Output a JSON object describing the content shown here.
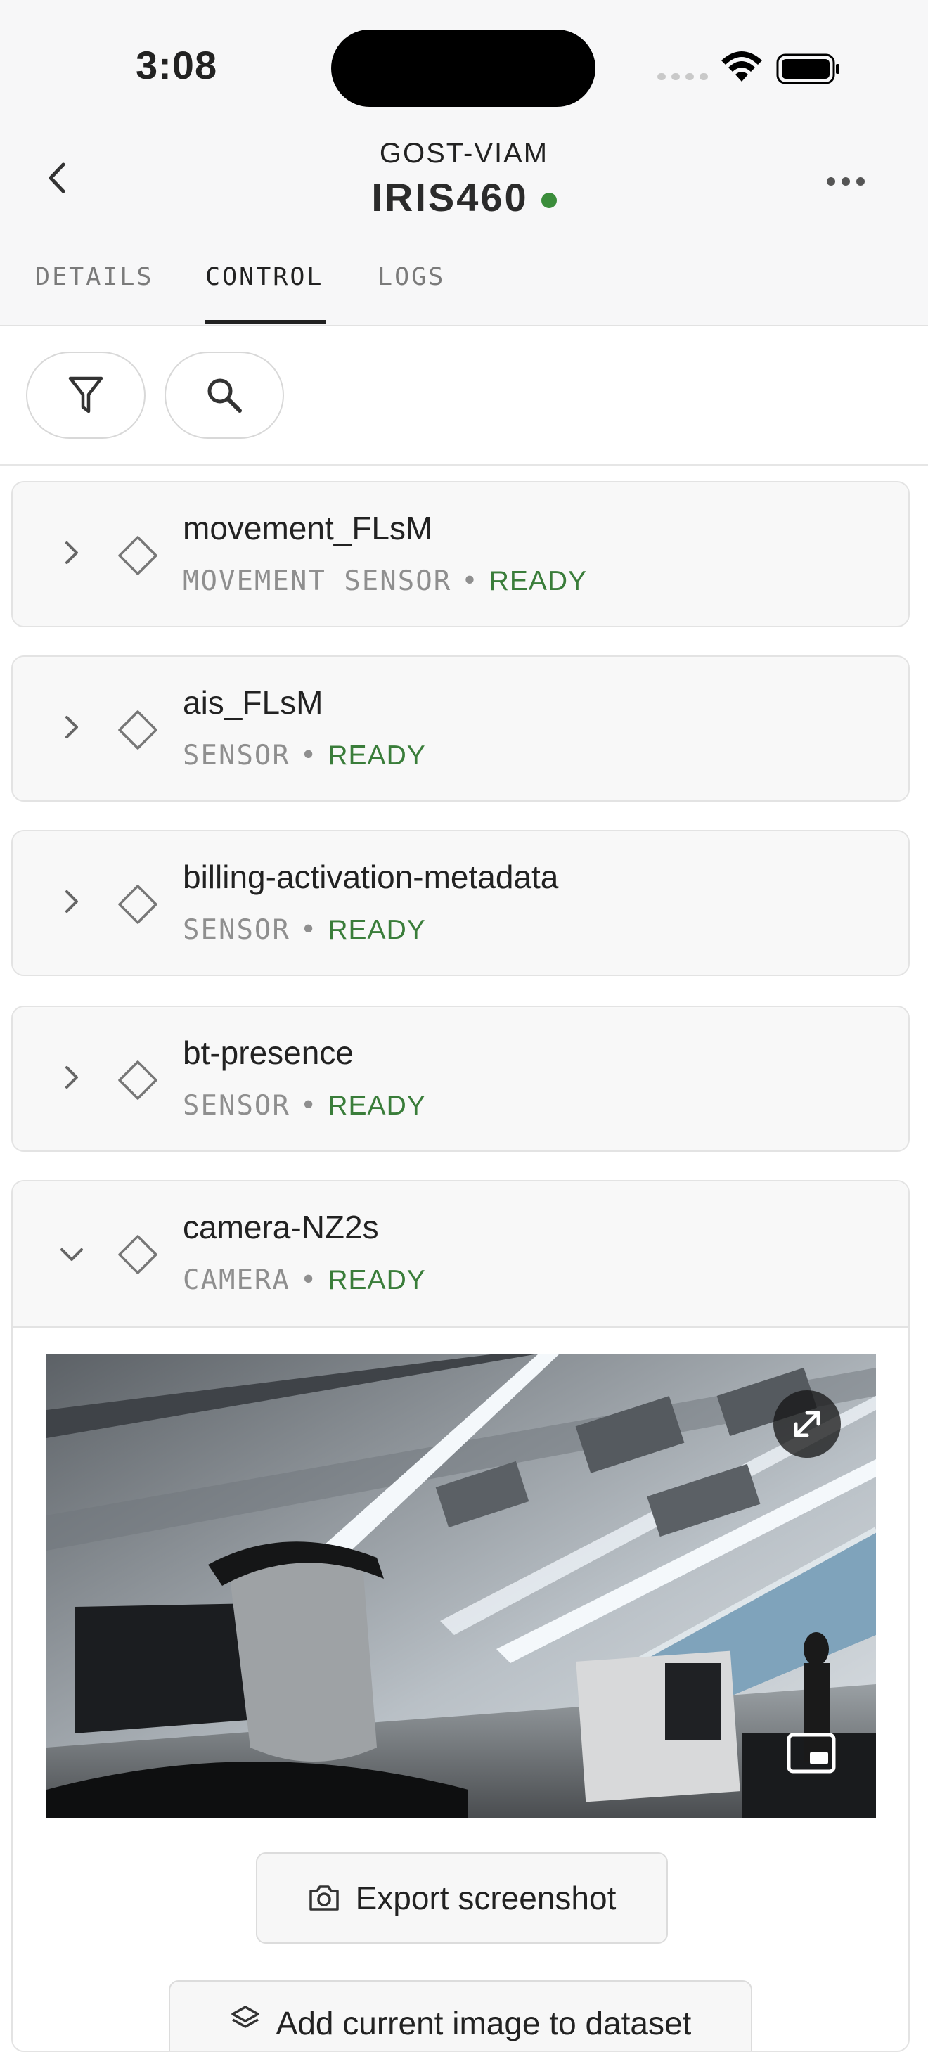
{
  "status_bar": {
    "time": "3:08"
  },
  "header": {
    "organization": "GOST-VIAM",
    "machine_name": "IRIS460",
    "machine_status_color": "#3b8d3b"
  },
  "tabs": [
    {
      "label": "DETAILS",
      "active": false
    },
    {
      "label": "CONTROL",
      "active": true
    },
    {
      "label": "LOGS",
      "active": false
    }
  ],
  "toolbar": {
    "filter_icon": "filter-icon",
    "search_icon": "search-icon"
  },
  "resources": [
    {
      "name": "movement_FLsM",
      "type": "MOVEMENT SENSOR",
      "separator": "•",
      "state": "READY",
      "expanded": false
    },
    {
      "name": "ais_FLsM",
      "type": "SENSOR",
      "separator": "•",
      "state": "READY",
      "expanded": false
    },
    {
      "name": "billing-activation-metadata",
      "type": "SENSOR",
      "separator": "•",
      "state": "READY",
      "expanded": false
    },
    {
      "name": "bt-presence",
      "type": "SENSOR",
      "separator": "•",
      "state": "READY",
      "expanded": false
    },
    {
      "name": "camera-NZ2s",
      "type": "CAMERA",
      "separator": "•",
      "state": "READY",
      "expanded": true
    }
  ],
  "camera_panel": {
    "export_label": "Export screenshot",
    "dataset_label": "Add current image to dataset"
  },
  "colors": {
    "ready": "#3a7d3a",
    "accent": "#222222"
  }
}
